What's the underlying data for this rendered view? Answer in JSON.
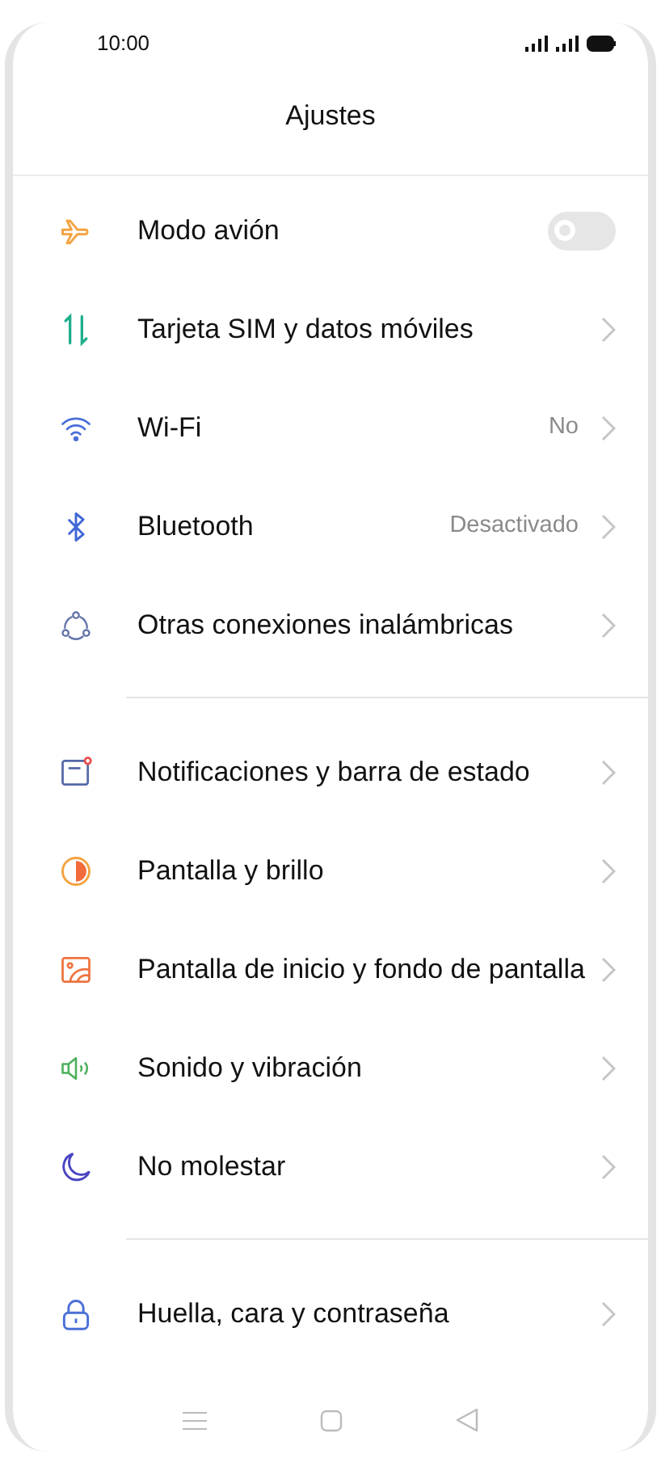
{
  "status_bar": {
    "time": "10:00"
  },
  "title": "Ajustes",
  "sections": [
    {
      "items": [
        {
          "label": "Modo avión",
          "kind": "toggle",
          "on": false
        },
        {
          "label": "Tarjeta SIM y datos móviles",
          "kind": "link"
        },
        {
          "label": "Wi-Fi",
          "kind": "link",
          "value": "No"
        },
        {
          "label": "Bluetooth",
          "kind": "link",
          "value": "Desactivado"
        },
        {
          "label": "Otras conexiones inalámbricas",
          "kind": "link"
        }
      ]
    },
    {
      "items": [
        {
          "label": "Notificaciones y barra de estado",
          "kind": "link"
        },
        {
          "label": "Pantalla y brillo",
          "kind": "link"
        },
        {
          "label": "Pantalla de inicio y fondo de pantalla",
          "kind": "link"
        },
        {
          "label": "Sonido y vibración",
          "kind": "link"
        },
        {
          "label": "No molestar",
          "kind": "link"
        }
      ]
    },
    {
      "items": [
        {
          "label": "Huella, cara y contraseña",
          "kind": "link"
        }
      ]
    }
  ]
}
